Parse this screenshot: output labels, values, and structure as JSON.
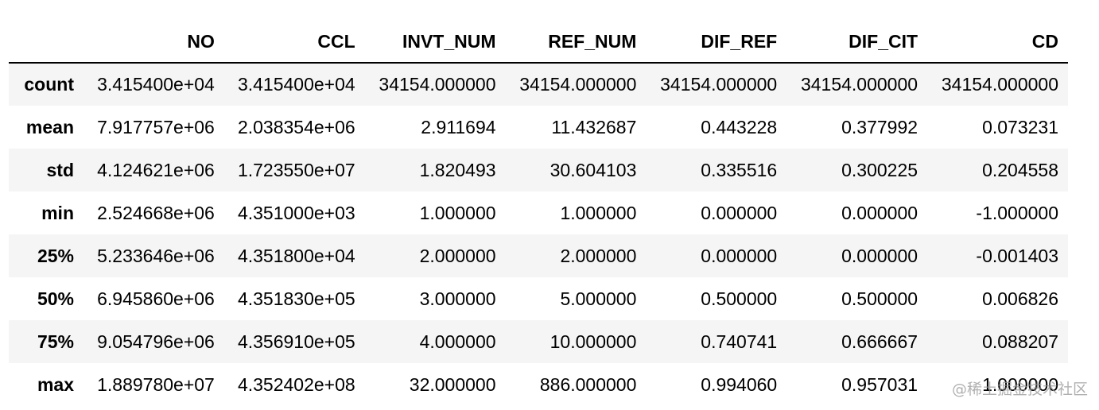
{
  "table": {
    "columns": [
      "",
      "NO",
      "CCL",
      "INVT_NUM",
      "REF_NUM",
      "DIF_REF",
      "DIF_CIT",
      "CD"
    ],
    "rows": [
      {
        "label": "count",
        "cells": [
          "3.415400e+04",
          "3.415400e+04",
          "34154.000000",
          "34154.000000",
          "34154.000000",
          "34154.000000",
          "34154.000000"
        ]
      },
      {
        "label": "mean",
        "cells": [
          "7.917757e+06",
          "2.038354e+06",
          "2.911694",
          "11.432687",
          "0.443228",
          "0.377992",
          "0.073231"
        ]
      },
      {
        "label": "std",
        "cells": [
          "4.124621e+06",
          "1.723550e+07",
          "1.820493",
          "30.604103",
          "0.335516",
          "0.300225",
          "0.204558"
        ]
      },
      {
        "label": "min",
        "cells": [
          "2.524668e+06",
          "4.351000e+03",
          "1.000000",
          "1.000000",
          "0.000000",
          "0.000000",
          "-1.000000"
        ]
      },
      {
        "label": "25%",
        "cells": [
          "5.233646e+06",
          "4.351800e+04",
          "2.000000",
          "2.000000",
          "0.000000",
          "0.000000",
          "-0.001403"
        ]
      },
      {
        "label": "50%",
        "cells": [
          "6.945860e+06",
          "4.351830e+05",
          "3.000000",
          "5.000000",
          "0.500000",
          "0.500000",
          "0.006826"
        ]
      },
      {
        "label": "75%",
        "cells": [
          "9.054796e+06",
          "4.356910e+05",
          "4.000000",
          "10.000000",
          "0.740741",
          "0.666667",
          "0.088207"
        ]
      },
      {
        "label": "max",
        "cells": [
          "1.889780e+07",
          "4.352402e+08",
          "32.000000",
          "886.000000",
          "0.994060",
          "0.957031",
          "1.000000"
        ]
      }
    ]
  },
  "watermark": "@稀土掘金技术社区"
}
